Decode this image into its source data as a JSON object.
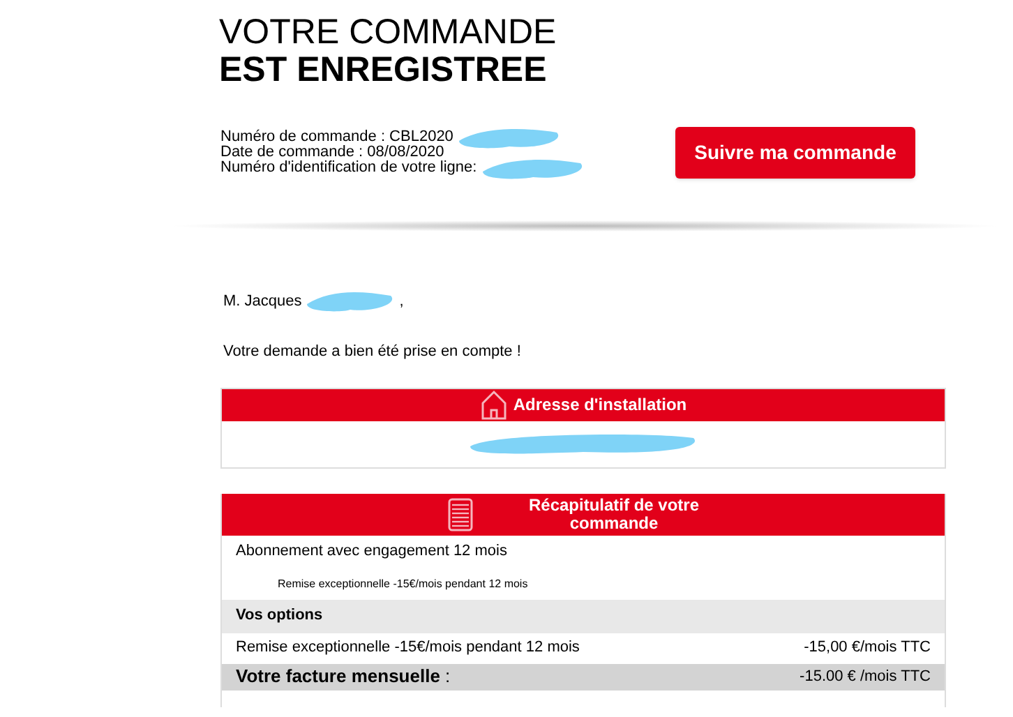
{
  "heading": {
    "line_1": "VOTRE COMMANDE",
    "line_2": "EST ENREGISTREE"
  },
  "order_info": [
    {
      "text": "Numéro de commande : CBL2020",
      "redacted": true
    },
    {
      "text": "Date de commande : 08/08/2020",
      "redacted": false
    },
    {
      "text": "Numéro d'identification de votre ligne:",
      "redacted": true
    }
  ],
  "track_button": {
    "label": "Suivre ma commande"
  },
  "greeting": {
    "name": "M. Jacques",
    "end": ","
  },
  "message": "Votre demande a bien été prise en compte !",
  "address_section": {
    "title": "Adresse d'installation",
    "redacted": true
  },
  "summary_section": {
    "title": "Récapitulatif de votre commande",
    "rows": [
      {
        "kind": "item",
        "label": "Abonnement avec engagement 12 mois"
      },
      {
        "kind": "subitem",
        "label": "Remise exceptionnelle -15€/mois pendant 12 mois"
      },
      {
        "kind": "section",
        "label": "Vos options"
      },
      {
        "kind": "priced",
        "label": "Remise exceptionnelle -15€/mois pendant 12 mois",
        "price": "-15,00 €/mois TTC"
      },
      {
        "kind": "total",
        "label": "Votre facture mensuelle",
        "suffix": ":",
        "price": "-15.00 € /mois TTC"
      }
    ]
  }
}
